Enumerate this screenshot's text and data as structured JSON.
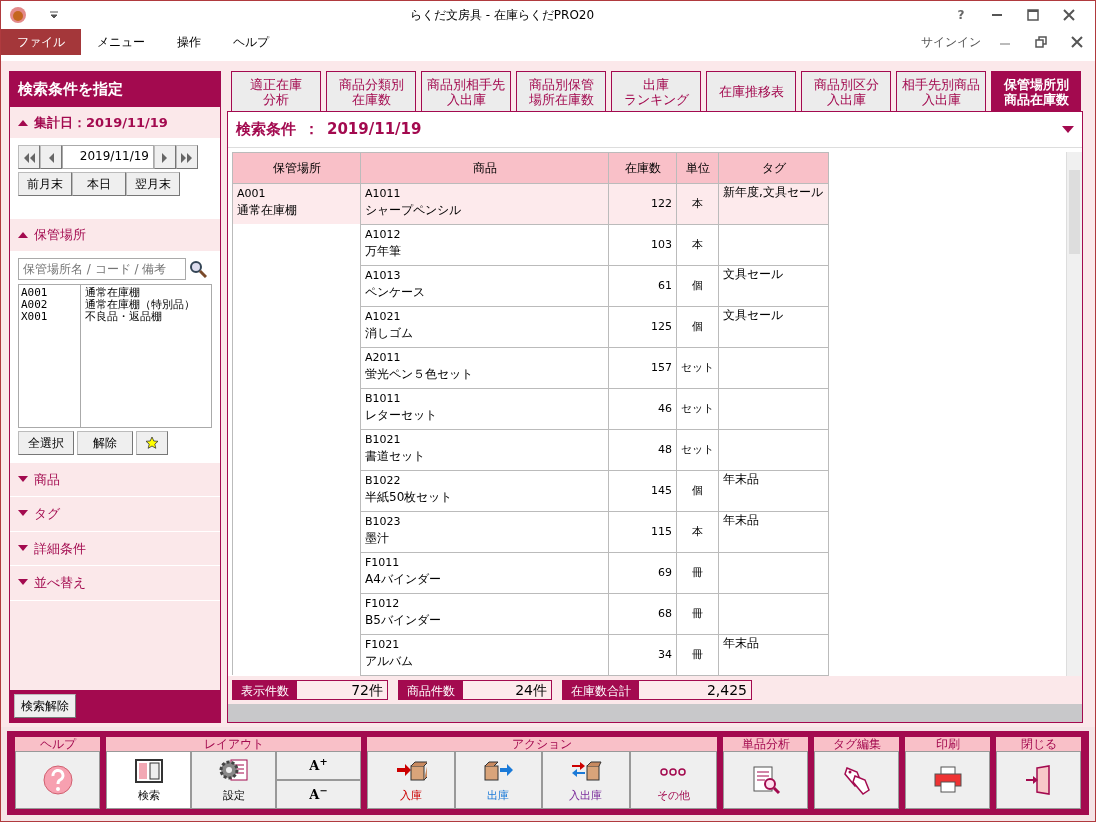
{
  "window": {
    "title": "らくだ文房具 - 在庫らくだPRO20",
    "help": "?",
    "signin": "サインイン"
  },
  "menu": [
    {
      "label": "ファイル",
      "selected": true
    },
    {
      "label": "メニュー",
      "selected": false
    },
    {
      "label": "操作",
      "selected": false
    },
    {
      "label": "ヘルプ",
      "selected": false
    }
  ],
  "sidebar": {
    "title": "検索条件を指定",
    "date_section": {
      "title": "集計日：2019/11/19",
      "expanded": true,
      "date": "2019/11/19",
      "buttons": [
        "前月末",
        "本日",
        "翌月末"
      ]
    },
    "location_section": {
      "title": "保管場所",
      "expanded": true,
      "placeholder": "保管場所名 / コード / 備考",
      "items": [
        {
          "code": "A001",
          "name": "通常在庫棚"
        },
        {
          "code": "A002",
          "name": "通常在庫棚（特別品）"
        },
        {
          "code": "X001",
          "name": "不良品・返品棚"
        }
      ],
      "buttons": [
        "全選択",
        "解除"
      ]
    },
    "sections": [
      {
        "title": "商品",
        "expanded": false
      },
      {
        "title": "タグ",
        "expanded": false
      },
      {
        "title": "詳細条件",
        "expanded": false
      },
      {
        "title": "並べ替え",
        "expanded": false
      }
    ],
    "clear_button": "検索解除"
  },
  "tabs": [
    {
      "lines": [
        "適正在庫",
        "分析"
      ],
      "selected": false
    },
    {
      "lines": [
        "商品分類別",
        "在庫数"
      ],
      "selected": false
    },
    {
      "lines": [
        "商品別相手先",
        "入出庫"
      ],
      "selected": false
    },
    {
      "lines": [
        "商品別保管",
        "場所在庫数"
      ],
      "selected": false
    },
    {
      "lines": [
        "出庫",
        "ランキング"
      ],
      "selected": false
    },
    {
      "lines": [
        "在庫推移表"
      ],
      "selected": false
    },
    {
      "lines": [
        "商品別区分",
        "入出庫"
      ],
      "selected": false
    },
    {
      "lines": [
        "相手先別商品",
        "入出庫"
      ],
      "selected": false
    },
    {
      "lines": [
        "保管場所別",
        "商品在庫数"
      ],
      "selected": true
    }
  ],
  "condition": {
    "label": "検索条件",
    "separator": "：",
    "value": "2019/11/19"
  },
  "table": {
    "columns": [
      "保管場所",
      "商品",
      "在庫数",
      "単位",
      "タグ"
    ],
    "rows": [
      {
        "location_code": "A001",
        "location_name": "通常在庫棚",
        "code": "A1011",
        "name": "シャープペンシル",
        "qty": "122",
        "unit": "本",
        "tag": "新年度,文具セール",
        "selected": true
      },
      {
        "code": "A1012",
        "name": "万年筆",
        "qty": "103",
        "unit": "本",
        "selected": false
      },
      {
        "code": "A1013",
        "name": "ペンケース",
        "qty": "61",
        "unit": "個",
        "tag": "文具セール",
        "selected": false
      },
      {
        "code": "A1021",
        "name": "消しゴム",
        "qty": "125",
        "unit": "個",
        "tag": "文具セール",
        "selected": false
      },
      {
        "code": "A2011",
        "name": "蛍光ペン５色セット",
        "qty": "157",
        "unit": "セット",
        "selected": false
      },
      {
        "code": "B1011",
        "name": "レターセット",
        "qty": "46",
        "unit": "セット",
        "selected": false
      },
      {
        "code": "B1021",
        "name": "書道セット",
        "qty": "48",
        "unit": "セット",
        "selected": false
      },
      {
        "code": "B1022",
        "name": "半紙50枚セット",
        "qty": "145",
        "unit": "個",
        "tag": "年末品",
        "selected": false
      },
      {
        "code": "B1023",
        "name": "墨汁",
        "qty": "115",
        "unit": "本",
        "tag": "年末品",
        "selected": false
      },
      {
        "code": "F1011",
        "name": "A4バインダー",
        "qty": "69",
        "unit": "冊",
        "selected": false
      },
      {
        "code": "F1012",
        "name": "B5バインダー",
        "qty": "68",
        "unit": "冊",
        "selected": false
      },
      {
        "code": "F1021",
        "name": "アルバム",
        "qty": "34",
        "unit": "冊",
        "tag": "年末品",
        "selected": false
      }
    ]
  },
  "summary": [
    {
      "label": "表示件数",
      "value": "72件"
    },
    {
      "label": "商品件数",
      "value": "24件"
    },
    {
      "label": "在庫数合計",
      "value": "2,425"
    }
  ],
  "toolbar": [
    {
      "label": "ヘルプ",
      "buttons": [
        {
          "kind": "help",
          "selected": false
        }
      ]
    },
    {
      "label": "レイアウト",
      "buttons": [
        {
          "kind": "layout",
          "label": "検索",
          "selected": true
        },
        {
          "kind": "settings",
          "label": "設定",
          "selected": false
        },
        {
          "kind": "fontsize",
          "up": "A$^{+}$",
          "down": "A$^{−}$",
          "selected": false
        }
      ]
    },
    {
      "label": "アクション",
      "buttons": [
        {
          "kind": "in",
          "label": "入庫",
          "selected": false
        },
        {
          "kind": "out",
          "label": "出庫",
          "selected": false
        },
        {
          "kind": "inout",
          "label": "入出庫",
          "selected": false
        },
        {
          "kind": "other",
          "label": "その他",
          "selected": false
        }
      ]
    },
    {
      "label": "単品分析",
      "buttons": [
        {
          "kind": "analyze",
          "selected": false
        }
      ]
    },
    {
      "label": "タグ編集",
      "buttons": [
        {
          "kind": "tag",
          "selected": false
        }
      ]
    },
    {
      "label": "印刷",
      "buttons": [
        {
          "kind": "print",
          "selected": false
        }
      ]
    },
    {
      "label": "閉じる",
      "buttons": [
        {
          "kind": "close",
          "selected": false
        }
      ]
    }
  ]
}
